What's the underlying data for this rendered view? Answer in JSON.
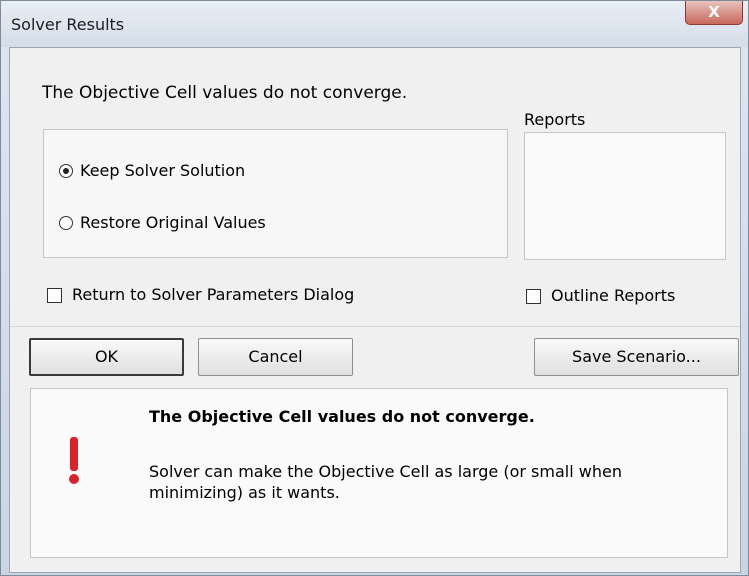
{
  "window": {
    "title": "Solver Results",
    "close_glyph": "X"
  },
  "main": {
    "heading": "The Objective Cell values do not converge.",
    "options": [
      {
        "label": "Keep Solver Solution",
        "selected": true
      },
      {
        "label": "Restore Original Values",
        "selected": false
      }
    ],
    "reports_label": "Reports",
    "reports_items": [],
    "return_dialog_label": "Return to Solver Parameters Dialog",
    "return_dialog_checked": false,
    "outline_reports_label": "Outline Reports",
    "outline_reports_checked": false
  },
  "buttons": {
    "ok": "OK",
    "cancel": "Cancel",
    "save_scenario": "Save Scenario..."
  },
  "message": {
    "icon": "exclamation-icon",
    "title": "The Objective Cell values do not converge.",
    "body": "Solver can make the Objective Cell as large (or small when minimizing) as it wants.",
    "accent_color": "#d8232a"
  }
}
